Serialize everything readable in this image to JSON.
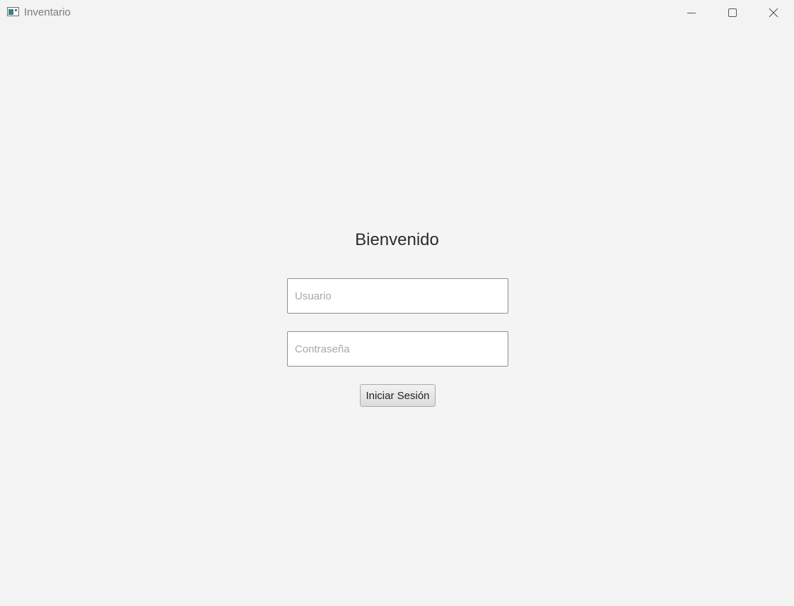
{
  "window": {
    "title": "Inventario",
    "icon": "app-window-icon",
    "controls": {
      "minimize": "minimize-icon",
      "maximize": "maximize-icon",
      "close": "close-icon"
    }
  },
  "login": {
    "heading": "Bienvenido",
    "username": {
      "value": "",
      "placeholder": "Usuario"
    },
    "password": {
      "value": "",
      "placeholder": "Contraseña"
    },
    "submit_label": "Iniciar Sesión"
  },
  "colors": {
    "background": "#f4f4f4",
    "field_border": "#8f8f8f",
    "placeholder": "#a8a8a8",
    "text": "#2b2b2b"
  }
}
